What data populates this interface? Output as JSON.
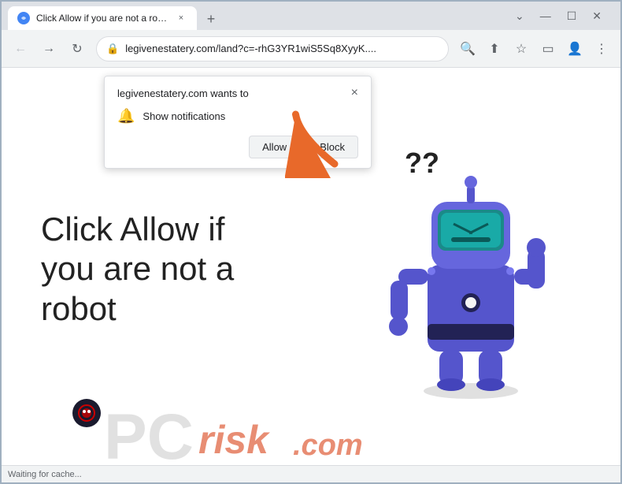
{
  "browser": {
    "tab": {
      "favicon": "🌐",
      "title": "Click Allow if you are not a robot",
      "close_label": "×"
    },
    "new_tab_label": "+",
    "window_controls": {
      "chevron_down": "⌄",
      "minimize": "—",
      "maximize": "☐",
      "close": "✕"
    },
    "toolbar": {
      "back_label": "←",
      "forward_label": "→",
      "reload_label": "↻",
      "url": "legivenestatery.com/land?c=-rhG3YR1wiS5Sq8XyyK....",
      "search_icon": "🔍",
      "share_icon": "⬆",
      "bookmark_icon": "☆",
      "sidebar_icon": "▭",
      "profile_icon": "👤",
      "menu_icon": "⋮"
    }
  },
  "notification_popup": {
    "origin": "legivenestatery.com wants to",
    "close_label": "×",
    "body_text": "Show notifications",
    "allow_label": "Allow",
    "block_label": "Block"
  },
  "page": {
    "main_text": "Click Allow if you are not a robot",
    "question_marks": "??",
    "status_text": "Waiting for cache..."
  },
  "pcrisk": {
    "pc_text": "PC",
    "risk_text": "risk",
    "dotcom_text": ".com"
  }
}
